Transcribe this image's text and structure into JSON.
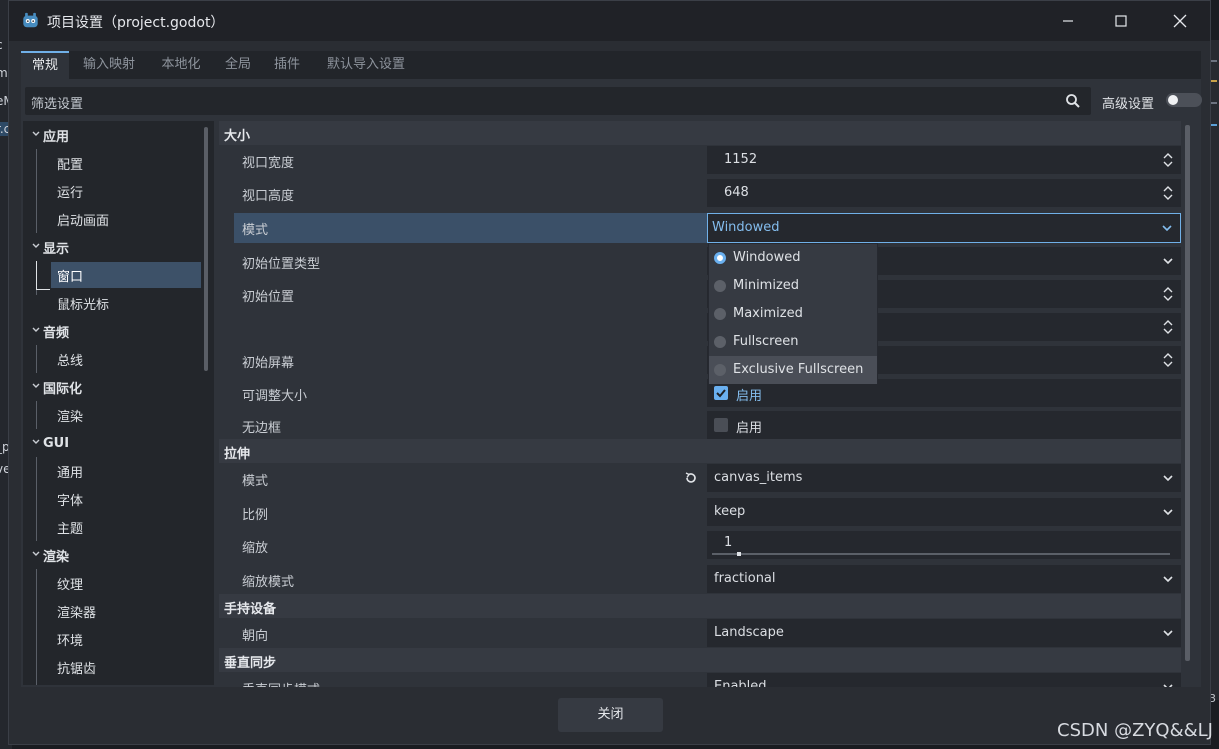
{
  "window": {
    "title": "项目设置（project.godot）"
  },
  "tabs": [
    "常规",
    "输入映射",
    "本地化",
    "全局",
    "插件",
    "默认导入设置"
  ],
  "filter": {
    "placeholder": "筛选设置",
    "advanced_label": "高级设置",
    "advanced_enabled": false
  },
  "sidebar": {
    "app": "应用",
    "config": "配置",
    "run": "运行",
    "boot": "启动画面",
    "display": "显示",
    "window": "窗口",
    "cursor": "鼠标光标",
    "audio": "音频",
    "bus": "总线",
    "i18n": "国际化",
    "i18n_render": "渲染",
    "gui": "GUI",
    "common": "通用",
    "fonts": "字体",
    "theme": "主题",
    "rendering": "渲染",
    "textures": "纹理",
    "renderer": "渲染器",
    "environment": "环境",
    "aa": "抗锯齿"
  },
  "inspector": {
    "size": {
      "section": "大小",
      "viewport_width_label": "视口宽度",
      "viewport_width": "1152",
      "viewport_height_label": "视口高度",
      "viewport_height": "648",
      "mode_label": "模式",
      "mode": "Windowed",
      "initial_position_type_label": "初始位置类型",
      "initial_position_label": "初始位置",
      "initial_screen_label": "初始屏幕",
      "resizable_label": "可调整大小",
      "resizable_text": "启用",
      "resizable": true,
      "borderless_label": "无边框",
      "borderless_text": "启用",
      "borderless": false
    },
    "stretch": {
      "section": "拉伸",
      "mode_label": "模式",
      "mode": "canvas_items",
      "aspect_label": "比例",
      "aspect": "keep",
      "scale_label": "缩放",
      "scale": "1",
      "scale_mode_label": "缩放模式",
      "scale_mode": "fractional"
    },
    "handheld": {
      "section": "手持设备",
      "orientation_label": "朝向",
      "orientation": "Landscape"
    },
    "vsync": {
      "section": "垂直同步",
      "mode_label": "垂直同步模式",
      "mode": "Enabled"
    }
  },
  "mode_dropdown": {
    "options": [
      "Windowed",
      "Minimized",
      "Maximized",
      "Fullscreen",
      "Exclusive Fullscreen"
    ],
    "selected": "Windowed",
    "hovered": "Exclusive Fullscreen"
  },
  "footer": {
    "close_label": "关闭"
  },
  "watermark": "CSDN @ZYQ&&LJ",
  "background_edge_text": [
    "c",
    "m",
    "eM",
    "r.c",
    "_p",
    "ve",
    "3"
  ],
  "colors": {
    "accent": "#70b0e8",
    "selection": "#3d5168",
    "panel": "#2f333a"
  }
}
